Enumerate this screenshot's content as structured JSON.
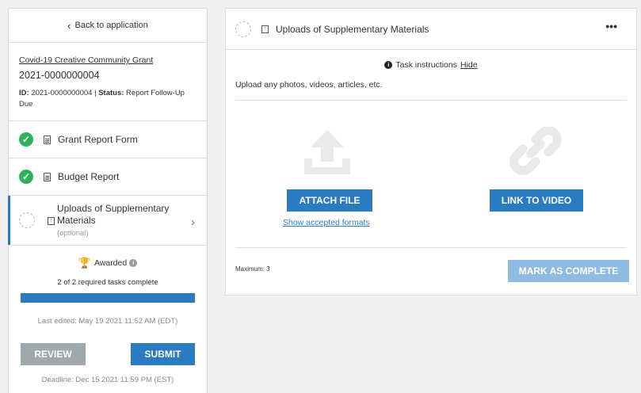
{
  "sidebar": {
    "back_label": "Back to application",
    "grant_name": "Covid-19 Creative Community Grant",
    "grant_number": "2021-0000000004",
    "id_label": "ID:",
    "id_value": "2021-0000000004",
    "status_label": "Status:",
    "status_value": "Report Follow-Up Due",
    "tasks": [
      {
        "label": "Grant Report Form",
        "state": "complete",
        "icon": "document-icon"
      },
      {
        "label": "Budget Report",
        "state": "complete",
        "icon": "document-icon"
      },
      {
        "label_line1": "Uploads of Supplementary",
        "label_line2": "Materials",
        "note": "(optional)",
        "state": "incomplete",
        "icon": "upload-icon",
        "active": true
      }
    ],
    "awarded_label": "Awarded",
    "required_tasks": "2 of 2 required tasks complete",
    "progress_fraction": 1.0,
    "last_edited": "Last edited: May 19 2021 11:52 AM (EDT)",
    "review_label": "REVIEW",
    "submit_label": "SUBMIT",
    "deadline": "Deadline: Dec 15 2021 11:59 PM (EST)"
  },
  "main": {
    "title": "Uploads of Supplementary Materials",
    "more_label": "•••",
    "instructions_label": "Task instructions",
    "hide_label": "Hide",
    "description": "Upload any photos, videos, articles, etc.",
    "attach_label": "ATTACH FILE",
    "formats_label": "Show accepted formats",
    "link_label": "LINK TO VIDEO",
    "maximum_label": "Maximum: 3",
    "mark_complete_label": "MARK AS COMPLETE"
  },
  "colors": {
    "accent": "#2b7bc2",
    "success": "#2eb35c",
    "disabled_accent": "#8fbbe3",
    "neutral_button": "#9ea8ad"
  }
}
